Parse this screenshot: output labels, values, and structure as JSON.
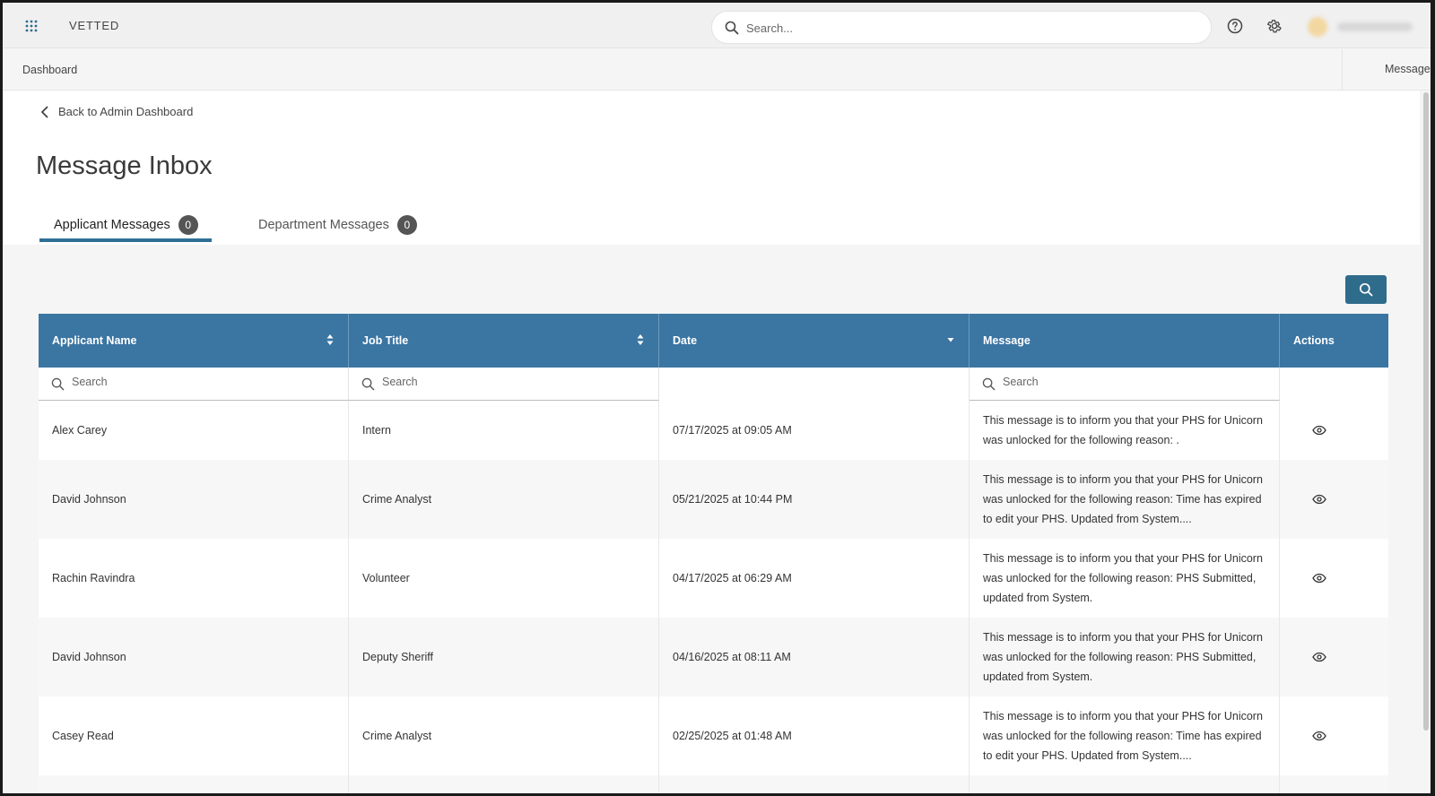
{
  "app": {
    "brand": "VETTED"
  },
  "search": {
    "placeholder": "Search..."
  },
  "breadcrumb": {
    "dashboard": "Dashboard",
    "messages": "Messages"
  },
  "back_link": "Back to Admin Dashboard",
  "page_title": "Message Inbox",
  "tabs": [
    {
      "label": "Applicant Messages",
      "count": "0",
      "active": true
    },
    {
      "label": "Department Messages",
      "count": "0",
      "active": false
    }
  ],
  "table": {
    "columns": [
      "Applicant Name",
      "Job Title",
      "Date",
      "Message",
      "Actions"
    ],
    "filter_placeholder": "Search",
    "rows": [
      {
        "name": "Alex Carey",
        "job": "Intern",
        "date": "07/17/2025 at 09:05 AM",
        "message": "This message is to inform you that your PHS for Unicorn was unlocked for the following reason: ."
      },
      {
        "name": "David Johnson",
        "job": "Crime Analyst",
        "date": "05/21/2025 at 10:44 PM",
        "message": "This message is to inform you that your PHS for Unicorn was unlocked for the following reason: Time has expired to edit your PHS. Updated from System...."
      },
      {
        "name": "Rachin Ravindra",
        "job": "Volunteer",
        "date": "04/17/2025 at 06:29 AM",
        "message": "This message is to inform you that your PHS for Unicorn was unlocked for the following reason: PHS Submitted, updated from System."
      },
      {
        "name": "David Johnson",
        "job": "Deputy Sheriff",
        "date": "04/16/2025 at 08:11 AM",
        "message": "This message is to inform you that your PHS for Unicorn was unlocked for the following reason: PHS Submitted, updated from System."
      },
      {
        "name": "Casey Read",
        "job": "Crime Analyst",
        "date": "02/25/2025 at 01:48 AM",
        "message": "This message is to inform you that your PHS for Unicorn was unlocked for the following reason: Time has expired to edit your PHS. Updated from System...."
      }
    ]
  },
  "icons": {
    "apps": "apps-grid-icon",
    "help": "help-icon",
    "settings": "gear-icon",
    "view": "eye-icon"
  },
  "colors": {
    "header": "#3b75a2",
    "accent": "#2f6c8c",
    "tab_underline": "#2f6f95"
  }
}
